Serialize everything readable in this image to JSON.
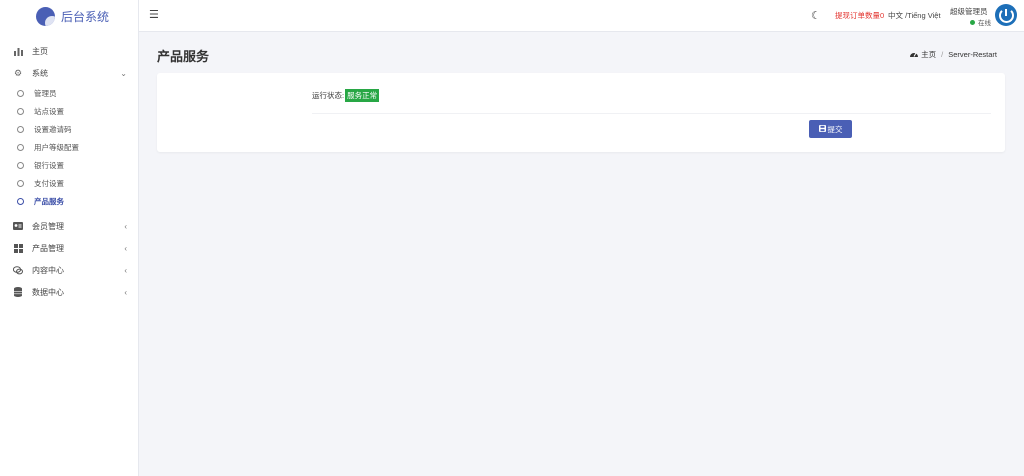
{
  "brand": {
    "title": "后台系统"
  },
  "sidebar": {
    "items": [
      {
        "label": "主页",
        "icon": "bar-chart-icon"
      },
      {
        "label": "系统",
        "icon": "gear-icon",
        "expanded": true,
        "children": [
          "管理员",
          "站点设置",
          "设置邀请码",
          "用户等级配置",
          "银行设置",
          "支付设置",
          "产品服务"
        ],
        "active_child": "产品服务"
      },
      {
        "label": "会员管理",
        "icon": "id-card-icon"
      },
      {
        "label": "产品管理",
        "icon": "grid-icon"
      },
      {
        "label": "内容中心",
        "icon": "chat-icon"
      },
      {
        "label": "数据中心",
        "icon": "database-icon"
      }
    ]
  },
  "header": {
    "withdraw_text": "提现订单数量0",
    "lang_text": "中文 /Tiếng Việt",
    "user_name": "超级管理员",
    "user_status": "在线"
  },
  "page": {
    "title": "产品服务",
    "breadcrumb": {
      "home": "主页",
      "current": "Server-Restart"
    },
    "status_label": "运行状态:",
    "status_value": "服务正常",
    "submit_label": "提交"
  },
  "colors": {
    "accent": "#4a5fb5",
    "status_ok": "#28a745",
    "alert": "#e3342f"
  }
}
